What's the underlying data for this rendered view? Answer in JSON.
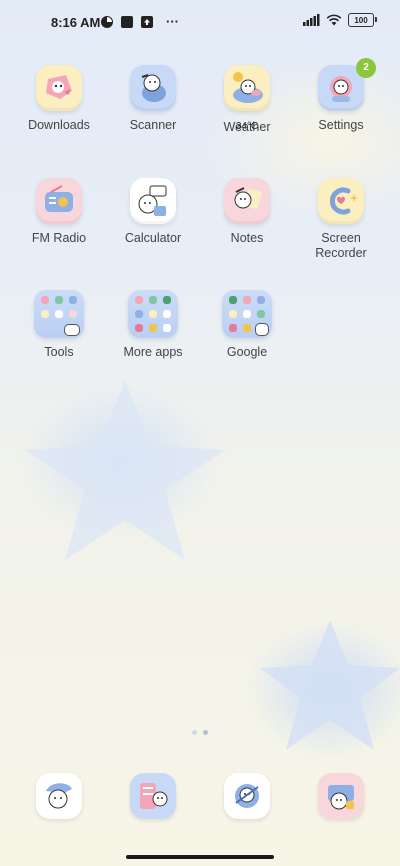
{
  "status_bar": {
    "time": "8:16 AM",
    "battery": "100",
    "more": "···",
    "icons": [
      "pie-notification-icon",
      "square-notification-icon",
      "upload-notification-icon",
      "signal-icon",
      "wifi-icon",
      "battery-icon"
    ]
  },
  "apps": {
    "downloads": {
      "label": "Downloads"
    },
    "scanner": {
      "label": "Scanner"
    },
    "weather": {
      "label": "Weather",
      "temp": "34°C"
    },
    "settings": {
      "label": "Settings",
      "badge": "2"
    },
    "fm_radio": {
      "label": "FM Radio"
    },
    "calculator": {
      "label": "Calculator"
    },
    "notes": {
      "label": "Notes"
    },
    "screen_recorder": {
      "label": "Screen\nRecorder"
    }
  },
  "folders": {
    "tools": {
      "label": "Tools"
    },
    "more_apps": {
      "label": "More apps"
    },
    "google": {
      "label": "Google"
    }
  },
  "page_indicator": {
    "pages": 2,
    "current": 2
  },
  "dock": [
    "dock-app-1",
    "dock-app-2",
    "dock-app-3",
    "dock-app-4"
  ],
  "colors": {
    "badge": "#8cc63f",
    "icon_yellow": "#fbeec0",
    "icon_blue": "#c7d9f6",
    "icon_pink": "#f7d6dc",
    "icon_white": "#ffffff"
  }
}
